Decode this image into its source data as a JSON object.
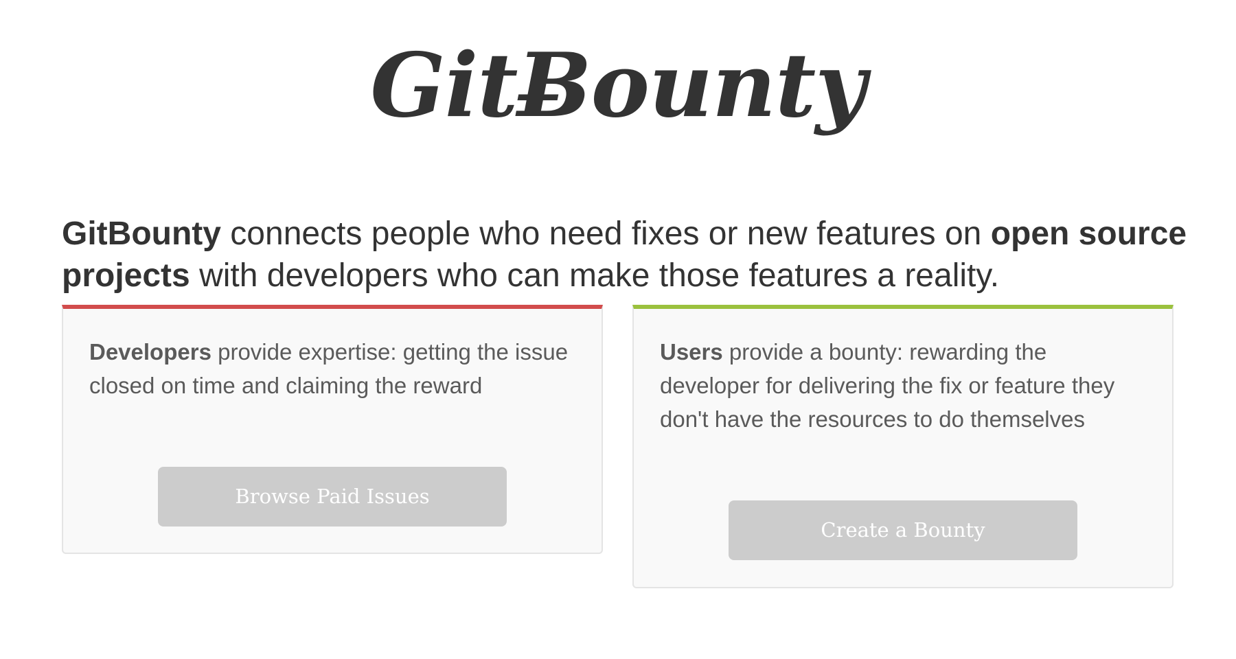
{
  "logo": {
    "text": "GitɃounty"
  },
  "intro": {
    "brand": "GitBounty",
    "text_1": " connects people who need fixes or new features on ",
    "emphasis": "open source projects",
    "text_2": " with developers who can make those features a reality."
  },
  "cards": [
    {
      "title": "Developers",
      "text": " provide expertise: getting the issue closed on time and claiming the reward",
      "button": "Browse Paid Issues",
      "accent": "#d24c4c"
    },
    {
      "title": "Users",
      "text": " provide a bounty: rewarding the developer for delivering the fix or feature they don't have the resources to do themselves",
      "button": "Create a Bounty",
      "accent": "#9bc13e"
    }
  ]
}
